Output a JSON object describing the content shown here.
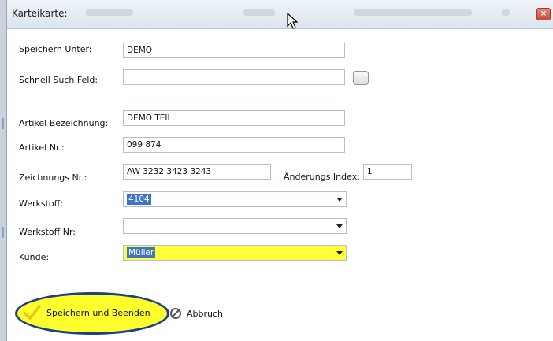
{
  "window": {
    "title": "Karteikarte:",
    "close_glyph": "×"
  },
  "form": {
    "speichern_unter": {
      "label": "Speichern Unter:",
      "value": "DEMO"
    },
    "schnell_such": {
      "label": "Schnell Such Feld:",
      "value": ""
    },
    "artikel_bezeichnung": {
      "label": "Artikel Bezeichnung:",
      "value": "DEMO TEIL"
    },
    "artikel_nr": {
      "label": "Artikel Nr.:",
      "value": "099 874"
    },
    "zeichnungs_nr": {
      "label": "Zeichnungs Nr.:",
      "value": "AW 3232 3423 3243"
    },
    "aenderungs_index": {
      "label": "Änderungs Index:",
      "value": "1"
    },
    "werkstoff": {
      "label": "Werkstoff:",
      "value": "4104"
    },
    "werkstoff_nr": {
      "label": "Werkstoff Nr:",
      "value": ""
    },
    "kunde": {
      "label": "Kunde:",
      "value": "Müller"
    }
  },
  "buttons": {
    "save": {
      "label": "Speichern und Beenden",
      "icon": "checkmark-icon"
    },
    "abort": {
      "label": "Abbruch",
      "icon": "no-entry-icon"
    }
  },
  "colors": {
    "highlight_yellow": "#ffff2e",
    "highlight_border": "#1d3f8a",
    "selection_blue": "#3e74c7",
    "check_green": "#e3c21a"
  }
}
